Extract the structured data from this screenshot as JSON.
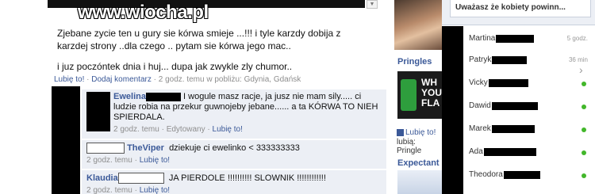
{
  "watermark": "www.wiocha.pl",
  "post": {
    "lines": [
      "Zjebane zycie ten u gury sie kórwa smieje ...!!! i tyle karzdy dobija z karzdej strony ..dla czego .. pytam sie kórwa jego mac..",
      "i juz poczóntek dnia i huj... dupa jak zwykle zly chumor.."
    ],
    "like_label": "Lubię to!",
    "comment_label": "Dodaj komentarz",
    "time": "2 godz. temu w pobliżu: Gdynia, Gdańsk"
  },
  "comments": [
    {
      "author": "Ewelina",
      "text": "I wogule masz racje, ja jusz nie mam sily..... ci ludzie robia na przekur guwnojeby jebane...... a ta KÓRWA  TO NIEH SPIERDALA.",
      "time": "2 godz. temu",
      "edited": "Edytowany",
      "like": "Lubię to!"
    },
    {
      "author": "TheViper",
      "text": "dziekuje ci ewelinko < 333333333",
      "time": "2 godz. temu",
      "like": "Lubię to!"
    },
    {
      "author": "Klaudia",
      "text": "JA PIERDOLE !!!!!!!!!! SLOWNIK !!!!!!!!!!!!",
      "time": "2 godz. temu",
      "like": "Lubię to!"
    }
  ],
  "ads": {
    "title": "Pringles",
    "image_text": "WH YOU FLA",
    "like_label": "Lubię to!",
    "likes_text": "lubią: Pringle",
    "title2": "Expectant"
  },
  "chat": {
    "top_text": "Uważasz że kobiety powinn...",
    "friends": [
      {
        "name": "Martina",
        "time": "5 godz."
      },
      {
        "name": "Patryk",
        "time": "36 min"
      },
      {
        "name": "Vicky",
        "time": ""
      },
      {
        "name": "Dawid",
        "time": ""
      },
      {
        "name": "Marek",
        "time": ""
      },
      {
        "name": "Ada",
        "time": ""
      },
      {
        "name": "Theodora",
        "time": ""
      }
    ]
  },
  "colors": {
    "link": "#3b5998",
    "comment_bg": "#eceff5",
    "online": "#42b72a"
  }
}
